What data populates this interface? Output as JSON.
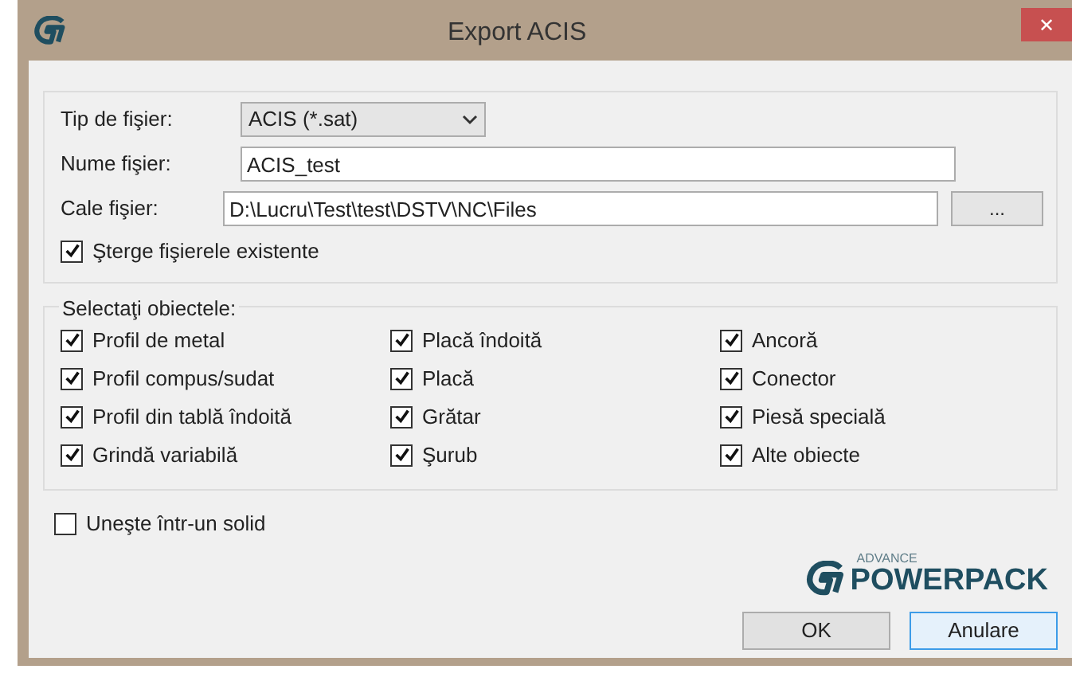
{
  "window": {
    "title": "Export ACIS",
    "close": "✕"
  },
  "file_settings": {
    "type": {
      "label": "Tip de fişier:",
      "value": "ACIS (*.sat)"
    },
    "name": {
      "label": "Nume fişier:",
      "value": "ACIS_test"
    },
    "path": {
      "label": "Cale fişier:",
      "value": "D:\\Lucru\\Test\\test\\DSTV\\NC\\Files",
      "browse": "..."
    },
    "overwrite": {
      "label": "Şterge fişierele existente",
      "checked": true
    }
  },
  "objects": {
    "legend": "Selectaţi obiectele:",
    "items": [
      {
        "label": "Profil de metal",
        "checked": true
      },
      {
        "label": "Placă îndoită",
        "checked": true
      },
      {
        "label": "Ancoră",
        "checked": true
      },
      {
        "label": "Profil compus/sudat",
        "checked": true
      },
      {
        "label": "Placă",
        "checked": true
      },
      {
        "label": "Conector",
        "checked": true
      },
      {
        "label": "Profil din tablă îndoită",
        "checked": true
      },
      {
        "label": "Grătar",
        "checked": true
      },
      {
        "label": "Piesă specială",
        "checked": true
      },
      {
        "label": "Grindă variabilă",
        "checked": true
      },
      {
        "label": "Şurub",
        "checked": true
      },
      {
        "label": "Alte obiecte",
        "checked": true
      }
    ]
  },
  "merge": {
    "label": "Uneşte într-un solid",
    "checked": false
  },
  "logo": {
    "top": "ADVANCE",
    "bottom": "POWERPACK"
  },
  "buttons": [
    {
      "label": "OK",
      "selected": false
    },
    {
      "label": "Anulare",
      "selected": true
    }
  ]
}
